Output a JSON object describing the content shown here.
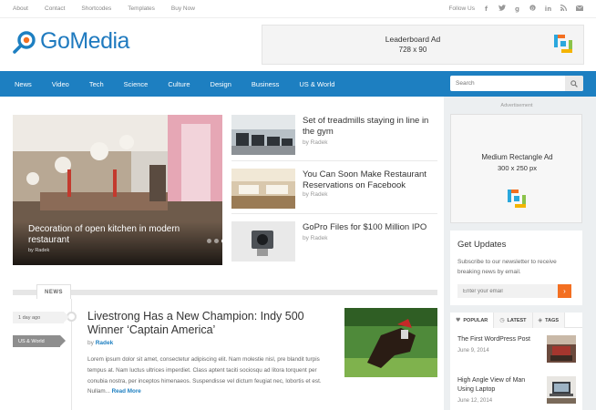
{
  "topbar": {
    "links": [
      "About",
      "Contact",
      "Shortcodes",
      "Templates",
      "Buy Now"
    ],
    "follow_label": "Follow Us",
    "social_icons": [
      "facebook-icon",
      "twitter-icon",
      "google-plus-icon",
      "pinterest-icon",
      "linkedin-icon",
      "rss-icon",
      "email-icon"
    ]
  },
  "brand": {
    "logo_text": "GoMedia",
    "accent": "#1d7fc1",
    "orange": "#f36f21"
  },
  "leaderboard": {
    "line1": "Leaderboard Ad",
    "line2": "728 x 90"
  },
  "nav": {
    "items": [
      "News",
      "Video",
      "Tech",
      "Science",
      "Culture",
      "Design",
      "Business",
      "US & World"
    ],
    "search_placeholder": "Search"
  },
  "hero": {
    "title": "Decoration of open kitchen in modern restaurant",
    "byline": "by Radek"
  },
  "stories": [
    {
      "title": "Set of treadmills staying in line in the gym",
      "byline": "by Radek"
    },
    {
      "title": "You Can Soon Make Restaurant Reservations on Facebook",
      "byline": "by Radek"
    },
    {
      "title": "GoPro Files for $100 Million IPO",
      "byline": "by Radek"
    }
  ],
  "news": {
    "tab_label": "NEWS",
    "time_ago": "1 day ago",
    "category": "US & World",
    "title": "Livestrong Has a New Champion: Indy 500 Winner ‘Captain America’",
    "by_prefix": "by",
    "author": "Radek",
    "excerpt": "Lorem ipsum dolor sit amet, consectetur adipiscing elit. Nam molestie nisl, pre blandit turpis tempus at. Nam luctus ultrices imperdiet. Class aptent taciti sociosqu ad litora torquent per conubia nostra, per inceptos himenaeos. Suspendisse vel dictum feugiat nec, lobortis et est. Nullam...",
    "read_more": "Read More"
  },
  "sidebar": {
    "advert_label": "Advertisement",
    "rect_ad": {
      "line1": "Medium Rectangle Ad",
      "line2": "300 x 250 px"
    },
    "updates": {
      "title": "Get Updates",
      "desc": "Subscribe to our newsletter to receive breaking news by email.",
      "email_placeholder": "Enter your email"
    },
    "tabs": [
      "POPULAR",
      "LATEST",
      "TAGS"
    ],
    "popular": [
      {
        "title": "The First WordPress Post",
        "date": "June 9, 2014"
      },
      {
        "title": "High Angle View of Man Using Laptop",
        "date": "June 12, 2014"
      }
    ]
  }
}
